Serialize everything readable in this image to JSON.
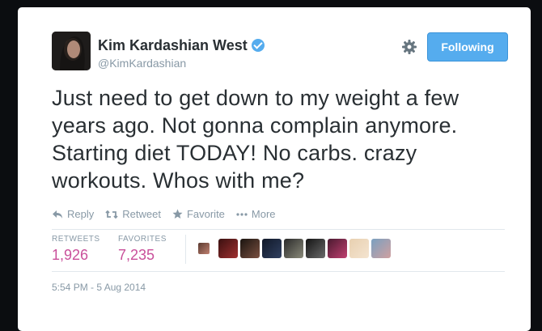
{
  "user": {
    "name": "Kim Kardashian West",
    "handle": "@KimKardashian"
  },
  "follow_button": {
    "label": "Following"
  },
  "tweet": {
    "text": "Just need to get down to my weight a few years ago. Not gonna complain anymore. Starting diet TODAY! No carbs. crazy workouts. Whos with me?"
  },
  "actions": {
    "reply": "Reply",
    "retweet": "Retweet",
    "favorite": "Favorite",
    "more": "More"
  },
  "stats": {
    "retweets_label": "RETWEETS",
    "retweets_value": "1,926",
    "favorites_label": "FAVORITES",
    "favorites_value": "7,235"
  },
  "timestamp": "5:54 PM - 5 Aug 2014",
  "colors": {
    "accent": "#55acee",
    "link": "#c94f9a",
    "text": "#292f33",
    "muted": "#8899a6"
  },
  "icons": [
    "verified-badge-icon",
    "gear-icon",
    "reply-icon",
    "retweet-icon",
    "star-icon",
    "more-dots-icon"
  ]
}
